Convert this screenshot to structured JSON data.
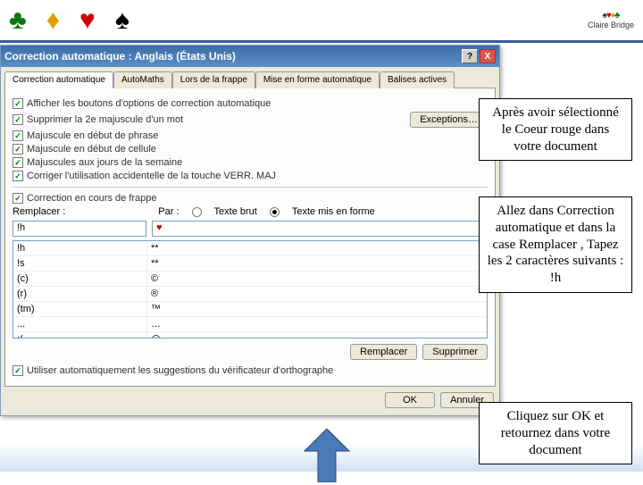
{
  "header": {
    "logo_text": "Claire Bridge"
  },
  "dialog": {
    "title": "Correction automatique : Anglais (États Unis)",
    "help": "?",
    "close": "X",
    "tabs": [
      "Correction automatique",
      "AutoMaths",
      "Lors de la frappe",
      "Mise en forme automatique",
      "Balises actives"
    ],
    "checks": [
      "Afficher les boutons d'options de correction automatique",
      "Supprimer la 2e majuscule d'un mot",
      "Majuscule en début de phrase",
      "Majuscule en début de cellule",
      "Majuscules aux jours de la semaine",
      "Corriger l'utilisation accidentelle de la touche VERR. MAJ"
    ],
    "exceptions": "Exceptions…",
    "check_repl": "Correction en cours de frappe",
    "replace_label": "Remplacer :",
    "by_label": "Par :",
    "radio_plain": "Texte brut",
    "radio_fmt": "Texte mis en forme",
    "replace_value": "!h",
    "by_value": "♥",
    "list": [
      {
        "k": "!h",
        "v": "**"
      },
      {
        "k": "!s",
        "v": "**"
      },
      {
        "k": "(c)",
        "v": "©"
      },
      {
        "k": "(r)",
        "v": "®"
      },
      {
        "k": "(tm)",
        "v": "™"
      },
      {
        "k": "...",
        "v": "…"
      },
      {
        "k": ":(",
        "v": "☹"
      }
    ],
    "btn_replace": "Remplacer",
    "btn_delete": "Supprimer",
    "check_spell": "Utiliser automatiquement les suggestions du vérificateur d'orthographe",
    "ok": "OK",
    "cancel": "Annuler"
  },
  "callouts": {
    "c1": "Après avoir sélectionné le Coeur rouge dans votre document",
    "c2": "Allez dans Correction automatique et dans la case Remplacer , Tapez les 2 caractères suivants : !h",
    "c3": "Cliquez sur OK et retournez dans votre document"
  }
}
